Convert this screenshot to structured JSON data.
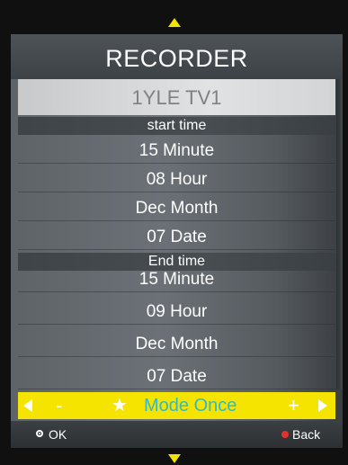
{
  "title": "RECORDER",
  "channel": "1YLE TV1",
  "start_section": {
    "header": "start time",
    "minute": "15 Minute",
    "hour": "08 Hour",
    "month": "Dec Month",
    "date": "07 Date"
  },
  "end_section": {
    "header": "End time",
    "minute": "15 Minute",
    "hour": "09 Hour",
    "month": "Dec Month",
    "date": "07 Date"
  },
  "mode_bar": {
    "minus": "-",
    "star": "★",
    "label": "Mode Once",
    "plus": "+"
  },
  "footer": {
    "ok_label": "OK",
    "back_label": "Back"
  },
  "colors": {
    "highlight": "#f4e400",
    "mode_text": "#33b9c9",
    "back_dot": "#e0332c",
    "arrows": "#f2e300"
  }
}
